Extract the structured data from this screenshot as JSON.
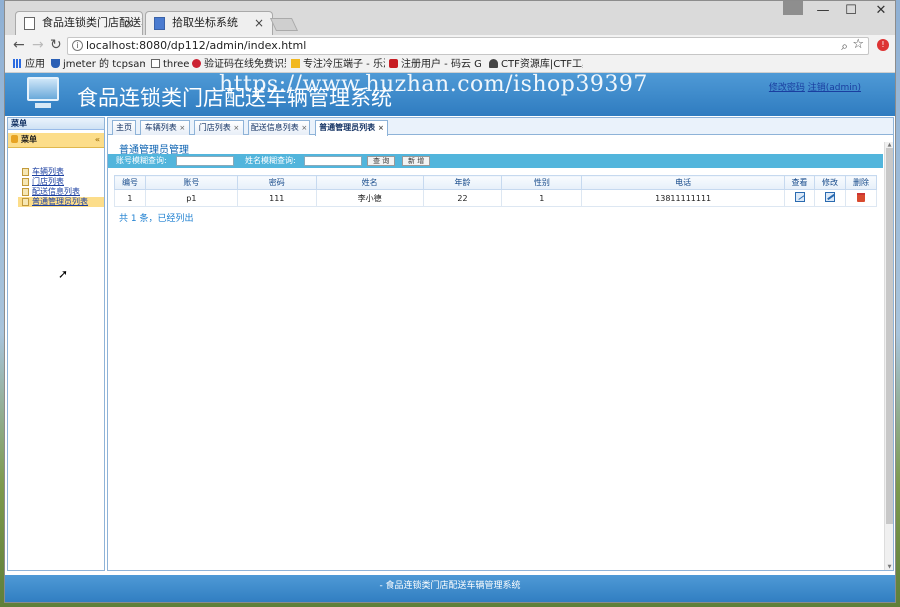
{
  "browser": {
    "tabs": [
      {
        "title": "食品连锁类门店配送车辆",
        "close": "×"
      },
      {
        "title": "拾取坐标系统",
        "close": "×"
      }
    ],
    "window_controls": {
      "minimize": "—",
      "maximize": "☐",
      "close": "✕"
    },
    "address": "localhost:8080/dp112/admin/index.html",
    "bookmarks": [
      "应用",
      "jmeter 的 tcpsample",
      "three",
      "验证码在线免费识别",
      "专注冷压端子 - 乐清",
      "注册用户 - 码云 Gitee",
      "CTF资源库|CTF工具下"
    ]
  },
  "header": {
    "system_name": "食品连锁类门店配送车辆管理系统",
    "watermark": "https://www.huzhan.com/ishop39397",
    "links": {
      "change_password": "修改密码",
      "logout": "注销(admin)"
    }
  },
  "sidebar": {
    "panel_title": "菜单",
    "group_title": "菜单",
    "collapse": "«",
    "items": [
      "车辆列表",
      "门店列表",
      "配送信息列表",
      "普通管理员列表"
    ]
  },
  "content": {
    "tabs": [
      {
        "label": "主页",
        "close": ""
      },
      {
        "label": "车辆列表",
        "close": "×"
      },
      {
        "label": "门店列表",
        "close": "×"
      },
      {
        "label": "配送信息列表",
        "close": "×"
      },
      {
        "label": "普通管理员列表",
        "close": "×"
      }
    ],
    "section_title": "普通管理员管理",
    "search": {
      "account_label": "账号模糊查询:",
      "account_value": "",
      "name_label": "姓名模糊查询:",
      "name_value": "",
      "query_button": "查 询",
      "add_button": "新 增"
    },
    "table": {
      "columns": [
        "编号",
        "账号",
        "密码",
        "姓名",
        "年龄",
        "性别",
        "电话",
        "查看",
        "修改",
        "删除"
      ],
      "rows": [
        [
          "1",
          "p1",
          "111",
          "李小德",
          "22",
          "1",
          "13811111111"
        ]
      ]
    },
    "summary": "共 1 条，已经列出"
  },
  "footer": {
    "text": "- 食品连锁类门店配送车辆管理系统"
  }
}
